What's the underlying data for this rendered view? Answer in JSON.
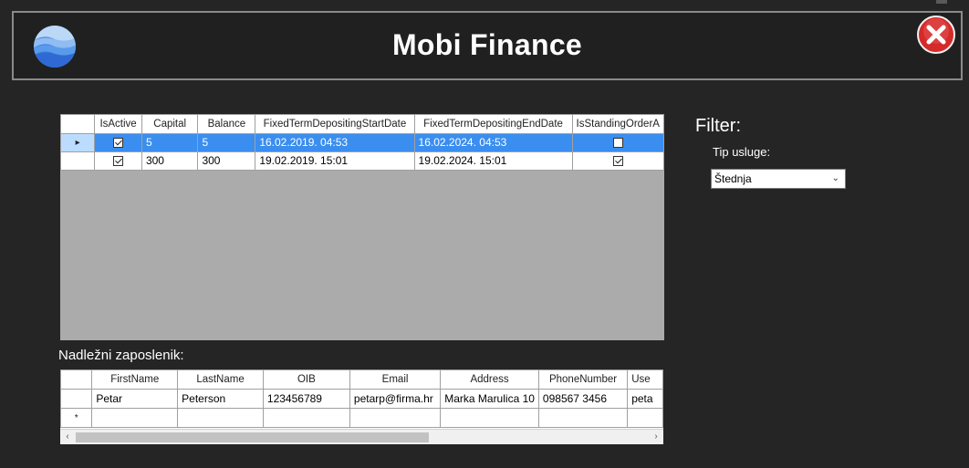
{
  "window": {
    "title": "Mobi Finance"
  },
  "icons": {
    "logo": "app-logo-icon",
    "close": "close-icon"
  },
  "services_grid": {
    "columns": [
      "IsActive",
      "Capital",
      "Balance",
      "FixedTermDepositingStartDate",
      "FixedTermDepositingEndDate",
      "IsStandingOrderA"
    ],
    "rows": [
      {
        "selected": true,
        "is_active": true,
        "capital": "5",
        "balance": "5",
        "start": "16.02.2019. 04:53",
        "end": "16.02.2024. 04:53",
        "standing_order": false
      },
      {
        "selected": false,
        "is_active": true,
        "capital": "300",
        "balance": "300",
        "start": "19.02.2019. 15:01",
        "end": "19.02.2024. 15:01",
        "standing_order": true
      }
    ],
    "row_indicator": "▸"
  },
  "filter": {
    "title": "Filter:",
    "service_type_label": "Tip usluge:",
    "service_type_value": "Štednja"
  },
  "employee": {
    "label": "Nadležni zaposlenik:",
    "columns": [
      "FirstName",
      "LastName",
      "OIB",
      "Email",
      "Address",
      "PhoneNumber",
      "Use"
    ],
    "rows": [
      {
        "first_name": "Petar",
        "last_name": "Peterson",
        "oib": "123456789",
        "email": "petarp@firma.hr",
        "address": "Marka Marulica 10",
        "phone": "098567 3456",
        "user": "peta"
      }
    ],
    "new_row_marker": "*"
  },
  "colors": {
    "background": "#252525",
    "selection": "#3a8ef0",
    "grid_empty": "#ababab"
  }
}
